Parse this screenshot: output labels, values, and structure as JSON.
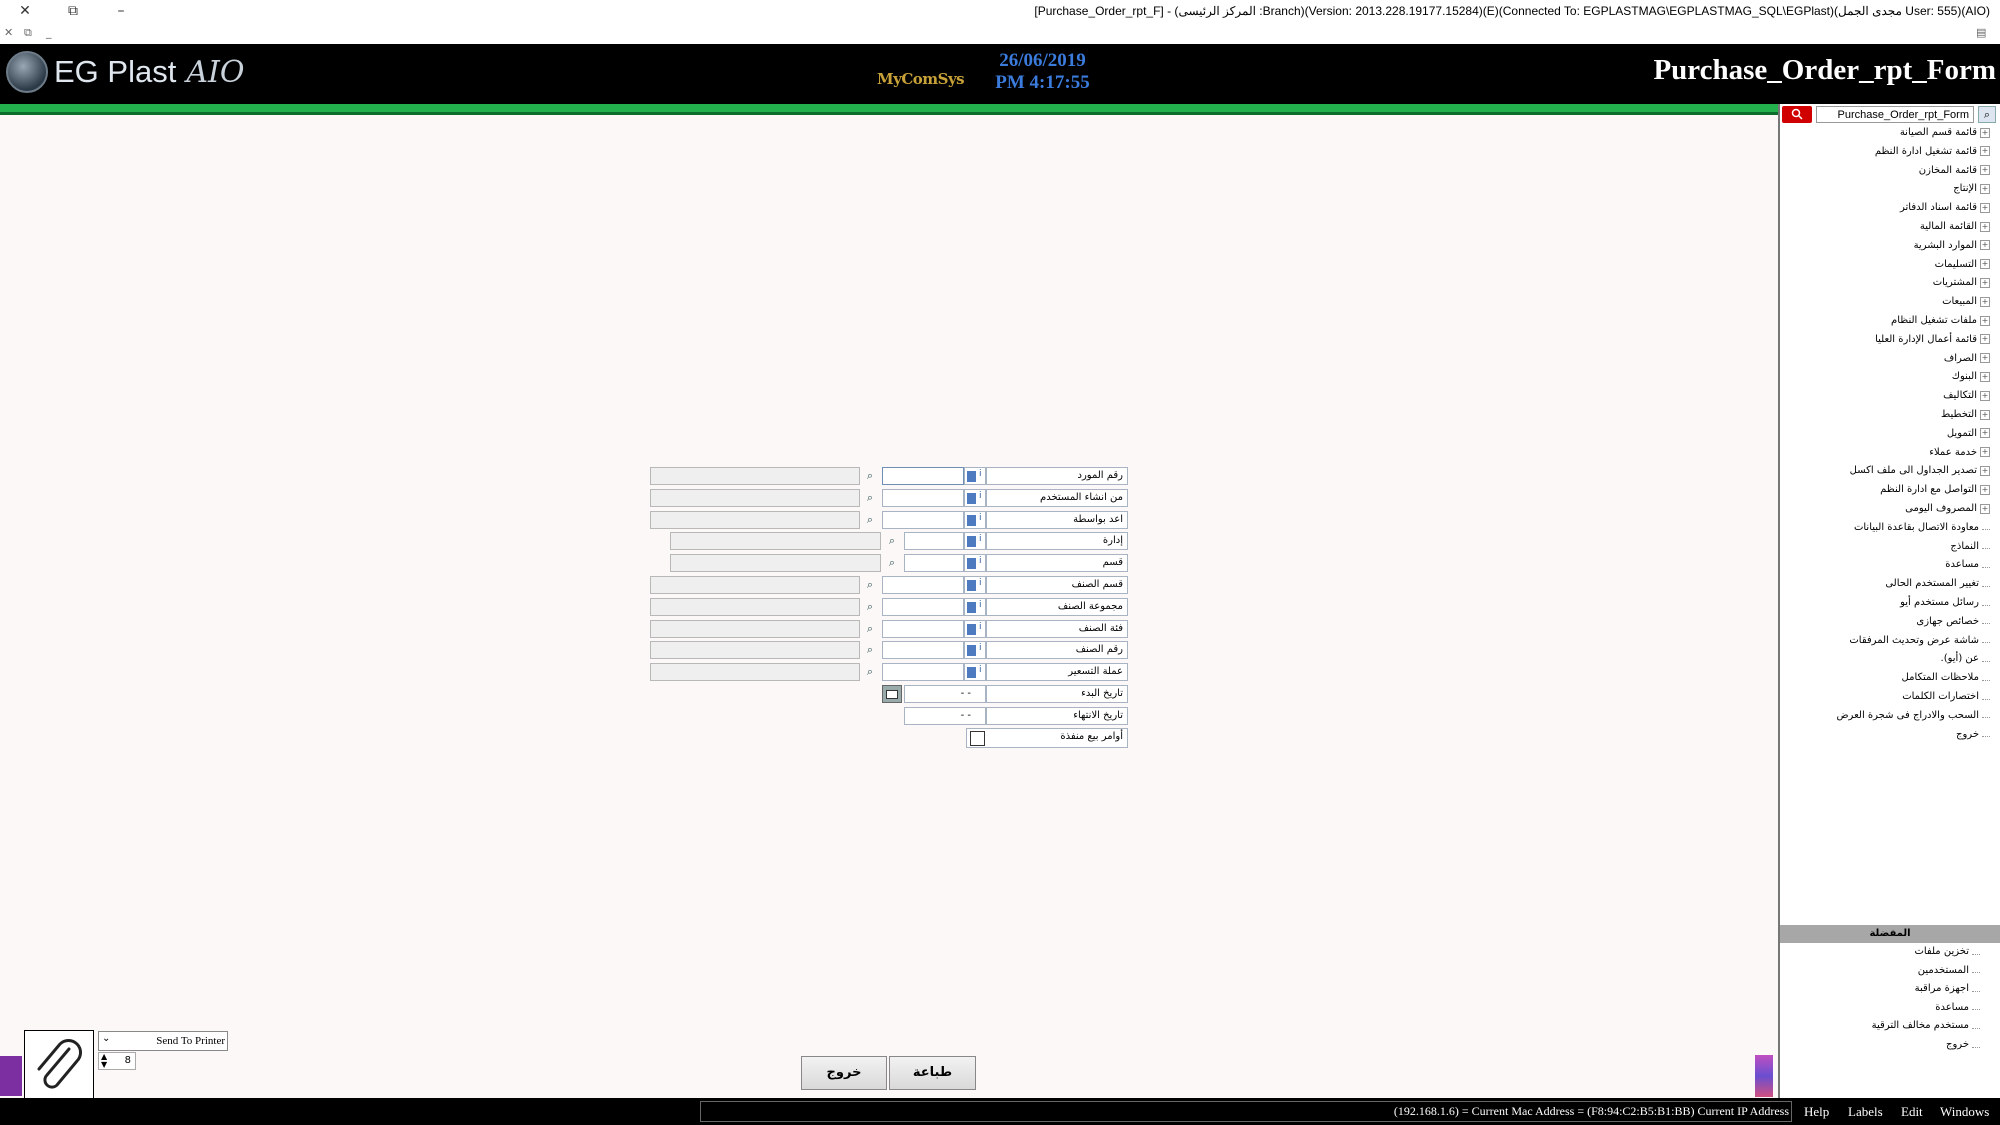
{
  "window": {
    "title": "[Purchase_Order_rpt_F] - (المركز الرئيسى :Branch)(Version: 2013.228.19177.15284)(E)(Connected To: EGPLASTMAG\\EGPLASTMAG_SQL\\EGPlast)(مجدى الجمل User: 555)(AIO)"
  },
  "header": {
    "logo_text": "EG Plast",
    "logo_suffix": "AIO",
    "vendor": "MyComSys",
    "date": "26/06/2019",
    "time": "PM 4:17:55",
    "form_title": "Purchase_Order_rpt_Form"
  },
  "right_panel": {
    "search_value": "Purchase_Order_rpt_Form",
    "tree_items": [
      {
        "label": "قائمة قسم الصيانة",
        "expandable": true
      },
      {
        "label": "قائمة تشغيل ادارة النظم",
        "expandable": true
      },
      {
        "label": "قائمة المخازن",
        "expandable": true
      },
      {
        "label": "الإنتاج",
        "expandable": true
      },
      {
        "label": "قائمة اسناد الدفاتر",
        "expandable": true
      },
      {
        "label": "القائمة المالية",
        "expandable": true
      },
      {
        "label": "الموارد البشرية",
        "expandable": true
      },
      {
        "label": "التسليمات",
        "expandable": true
      },
      {
        "label": "المشتريات",
        "expandable": true
      },
      {
        "label": "المبيعات",
        "expandable": true
      },
      {
        "label": "ملفات تشغيل النظام",
        "expandable": true
      },
      {
        "label": "قائمة أعمال الإدارة العليا",
        "expandable": true
      },
      {
        "label": "الصراف",
        "expandable": true
      },
      {
        "label": "البنوك",
        "expandable": true
      },
      {
        "label": "التكاليف",
        "expandable": true
      },
      {
        "label": "التخطيط",
        "expandable": true
      },
      {
        "label": "التمويل",
        "expandable": true
      },
      {
        "label": "خدمة عملاء",
        "expandable": true
      },
      {
        "label": "تصدير الجداول الى ملف اكسل",
        "expandable": true
      },
      {
        "label": "التواصل مع ادارة النظم",
        "expandable": true
      },
      {
        "label": "المصروف اليومى",
        "expandable": true
      },
      {
        "label": "معاودة الاتصال بقاعدة البيانات",
        "expandable": false
      },
      {
        "label": "النماذج",
        "expandable": false
      },
      {
        "label": "مساعدة",
        "expandable": false
      },
      {
        "label": "تغيير المستخدم الحالى",
        "expandable": false
      },
      {
        "label": "رسائل مستخدم أيو",
        "expandable": false
      },
      {
        "label": "خصائص جهازى",
        "expandable": false
      },
      {
        "label": "شاشة عرض وتحديث المرفقات",
        "expandable": false
      },
      {
        "label": "عن (أيو).",
        "expandable": false
      },
      {
        "label": "ملاحظات المتكامل",
        "expandable": false
      },
      {
        "label": "اختصارات الكلمات",
        "expandable": false
      },
      {
        "label": "السحب والادراج فى شجرة العرض",
        "expandable": false
      },
      {
        "label": "خروج",
        "expandable": false
      }
    ],
    "favorites_title": "المفضلة",
    "favorites": [
      "تخزين ملفات",
      "المستخدمين",
      "اجهزة مراقبة",
      "مساعدة",
      "مستخدم مخالف الترقية",
      "خروج"
    ]
  },
  "form": {
    "fields": [
      {
        "label": "رقم المورد"
      },
      {
        "label": "من انشاء المستخدم"
      },
      {
        "label": "اعد بواسطة"
      },
      {
        "label": "إدارة"
      },
      {
        "label": "قسم"
      },
      {
        "label": "قسم الصنف"
      },
      {
        "label": "مجموعة الصنف"
      },
      {
        "label": "فئة الصنف"
      },
      {
        "label": "رقم الصنف"
      },
      {
        "label": "عملة التسعير"
      }
    ],
    "start_date_label": "تاريخ البدء",
    "start_date_value": "- -",
    "end_date_label": "تاريخ الانتهاء",
    "end_date_value": "- -",
    "executed_label": "أوامر بيع منفذة",
    "executed_checked": false
  },
  "buttons": {
    "print": "طباعة",
    "exit": "خروج"
  },
  "printer": {
    "selected": "Send To Printer",
    "copies": "8"
  },
  "status": {
    "text": "(192.168.1.6) = Current Mac Address = (F8:94:C2:B5:B1:BB) Current IP Address",
    "menu": [
      "Help",
      "Labels",
      "Edit",
      "Windows"
    ]
  }
}
